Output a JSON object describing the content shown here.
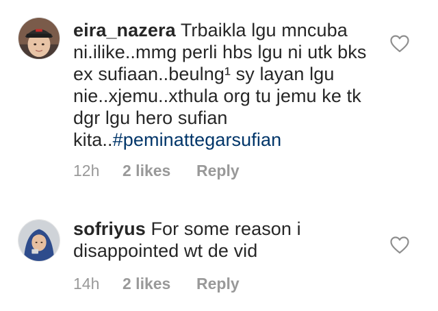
{
  "comments": [
    {
      "username": "eira_nazera",
      "text": "Trbaikla lgu mncuba ni.ilike..mmg perli hbs lgu ni utk bks ex sufiaan..beulng¹ sy layan lgu nie..xjemu..xthula org tu jemu ke tk dgr lgu hero sufian kita..",
      "hashtag": "#peminattegarsufian",
      "time": "12h",
      "likes": "2 likes",
      "reply_label": "Reply",
      "avatar_icon": "profile-avatar"
    },
    {
      "username": "sofriyus",
      "text": "For some reason i disappointed wt de vid",
      "time": "14h",
      "likes": "2 likes",
      "reply_label": "Reply",
      "avatar_icon": "profile-avatar"
    }
  ],
  "colors": {
    "text": "#262626",
    "meta": "#999999",
    "hashtag": "#003569",
    "heart_stroke": "#8e8e8e"
  },
  "icons": {
    "like": "heart-outline-icon"
  }
}
